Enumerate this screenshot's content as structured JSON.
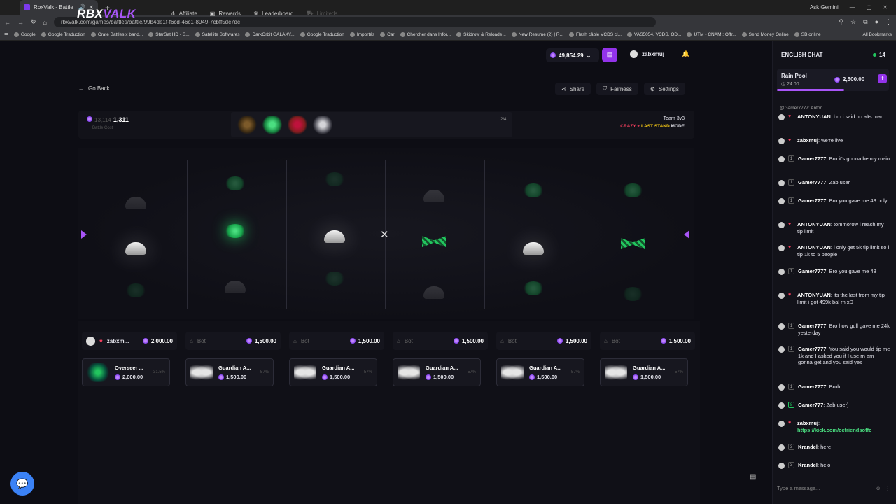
{
  "browser": {
    "tab_title": "RbxValk - Battle",
    "url": "rbxvalk.com/games/battles/battle/99b4de1f-f6cd-46c1-8949-7cbff5dc7dc",
    "ask_gemini": "Ask Gemini",
    "bookmarks": [
      "Google",
      "Google Traduction",
      "Crate Battles x band...",
      "StarSat HD - S...",
      "Satellite Softwares",
      "DarkOrbit GALAXY...",
      "Google Traduction",
      "Importés",
      "Car",
      "Chercher dans Infor...",
      "Skidrow & Reloade...",
      "New Resume (2) | R...",
      "Flash câble VCDS cl...",
      "VAS5054, VCDS, OD...",
      "UTM - CNAM : Offr...",
      "Send Money Online",
      "SB online"
    ],
    "all_bookmarks": "All Bookmarks"
  },
  "nav": {
    "logo_main": "RBX",
    "logo_accent": "VALK",
    "links": [
      "Affiliate",
      "Rewards",
      "Leaderboard",
      "Limiteds"
    ],
    "balance": "49,854.29",
    "username": "zabxmuj"
  },
  "toolbar": {
    "go_back": "Go Back",
    "share": "Share",
    "fairness": "Fairness",
    "settings": "Settings"
  },
  "battle": {
    "old_cost": "13,114",
    "cost": "1,311",
    "cost_label": "Battle Cost",
    "round": "2/4",
    "team": "Team 3v3",
    "mode_crazy": "CRAZY",
    "mode_plus": " + ",
    "mode_last": "LAST STAND",
    "mode_suffix": " MODE"
  },
  "players": [
    {
      "name": "zabxm...",
      "value": "2,000.00",
      "drop_name": "Overseer ...",
      "drop_value": "2,000.00",
      "drop_pct": "31.5%"
    },
    {
      "name": "Bot",
      "value": "1,500.00",
      "drop_name": "Guardian A...",
      "drop_value": "1,500.00",
      "drop_pct": "57%"
    },
    {
      "name": "Bot",
      "value": "1,500.00",
      "drop_name": "Guardian A...",
      "drop_value": "1,500.00",
      "drop_pct": "57%"
    },
    {
      "name": "Bot",
      "value": "1,500.00",
      "drop_name": "Guardian A...",
      "drop_value": "1,500.00",
      "drop_pct": "57%"
    },
    {
      "name": "Bot",
      "value": "1,500.00",
      "drop_name": "Guardian A...",
      "drop_value": "1,500.00",
      "drop_pct": "57%"
    },
    {
      "name": "Bot",
      "value": "1,500.00",
      "drop_name": "Guardian A...",
      "drop_value": "1,500.00",
      "drop_pct": "57%"
    }
  ],
  "chat": {
    "title": "ENGLISH CHAT",
    "online": "14",
    "rain_title": "Rain Pool",
    "rain_time": "24:00",
    "rain_amount": "2,500.00",
    "reply_line": "@Gamer7777: Anton",
    "messages": [
      {
        "level": "",
        "user": "ANTONYUAN",
        "text": "bro i said no alts man"
      },
      {
        "level": "",
        "user": "zabxmuj",
        "text": "we're live"
      },
      {
        "level": "1",
        "user": "Gamer7777",
        "text": "Bro it's gonna be my main"
      },
      {
        "level": "1",
        "user": "Gamer7777",
        "text": "Zab user"
      },
      {
        "level": "1",
        "user": "Gamer7777",
        "text": "Bro you gave me 48 only"
      },
      {
        "level": "",
        "user": "ANTONYUAN",
        "text": "tommorow i reach my tip limit"
      },
      {
        "level": "",
        "user": "ANTONYUAN",
        "text": "i only get 5k tip limit so i tip 1k to 5 people"
      },
      {
        "level": "1",
        "user": "Gamer7777",
        "text": "Bro you gave me 48"
      },
      {
        "level": "",
        "user": "ANTONYUAN",
        "text": "its the last from my tip limit i got 499k bal rn xD"
      },
      {
        "level": "1",
        "user": "Gamer7777",
        "text": "Bro how gull gave me 24k yesterday"
      },
      {
        "level": "1",
        "user": "Gamer7777",
        "text": "You said you would tip me 1k and I asked you if I use rn am I gonna get and you said yes"
      },
      {
        "level": "1",
        "user": "Gamer7777",
        "text": "Bruh"
      },
      {
        "level": "8",
        "user": "Gamer777",
        "text": "Zab user)"
      },
      {
        "level": "",
        "user": "zabxmuj",
        "text": "https://kick.com/ccfriendsoffc"
      },
      {
        "level": "3",
        "user": "Krandel",
        "text": "here"
      },
      {
        "level": "3",
        "user": "Krandel",
        "text": "helo"
      }
    ],
    "input_placeholder": "Type a message..."
  }
}
